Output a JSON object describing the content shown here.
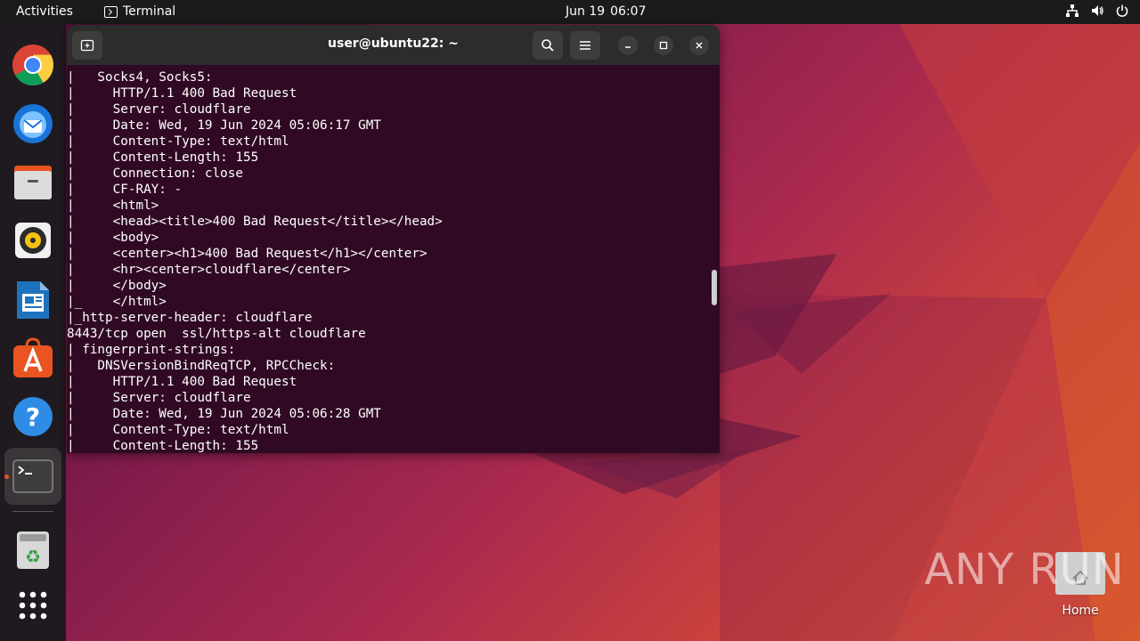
{
  "topbar": {
    "activities": "Activities",
    "app_name": "Terminal",
    "date": "Jun 19",
    "time": "06:07",
    "tray_icons": [
      "network-icon",
      "volume-icon",
      "power-icon"
    ]
  },
  "dock": {
    "items": [
      "chrome-icon",
      "thunderbird-icon",
      "files-icon",
      "rhythmbox-icon",
      "libreoffice-writer-icon",
      "app-center-icon",
      "help-icon",
      "terminal-icon",
      "trash-icon",
      "show-apps-icon"
    ],
    "active": "terminal-icon",
    "accent": "#e95420"
  },
  "terminal": {
    "title": "user@ubuntu22: ~",
    "background": "#300a24",
    "lines": [
      "|   Socks4, Socks5:",
      "|     HTTP/1.1 400 Bad Request",
      "|     Server: cloudflare",
      "|     Date: Wed, 19 Jun 2024 05:06:17 GMT",
      "|     Content-Type: text/html",
      "|     Content-Length: 155",
      "|     Connection: close",
      "|     CF-RAY: -",
      "|     <html>",
      "|     <head><title>400 Bad Request</title></head>",
      "|     <body>",
      "|     <center><h1>400 Bad Request</h1></center>",
      "|     <hr><center>cloudflare</center>",
      "|     </body>",
      "|_    </html>",
      "|_http-server-header: cloudflare",
      "8443/tcp open  ssl/https-alt cloudflare",
      "| fingerprint-strings:",
      "|   DNSVersionBindReqTCP, RPCCheck:",
      "|     HTTP/1.1 400 Bad Request",
      "|     Server: cloudflare",
      "|     Date: Wed, 19 Jun 2024 05:06:28 GMT",
      "|     Content-Type: text/html",
      "|     Content-Length: 155"
    ]
  },
  "desktop": {
    "home_label": "Home",
    "watermark": "ANY RUN"
  }
}
